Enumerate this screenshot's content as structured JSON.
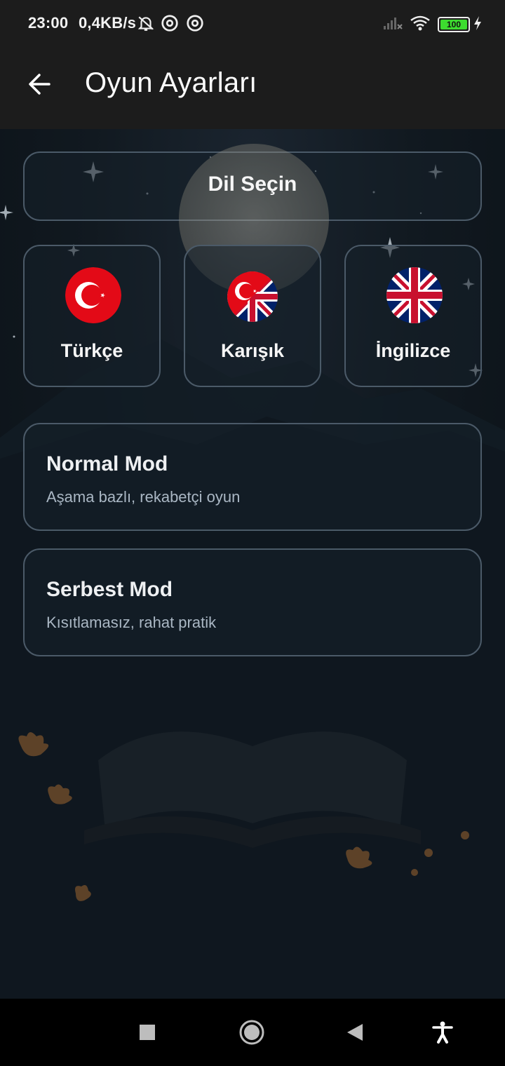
{
  "status_bar": {
    "time": "23:00",
    "network_speed": "0,4KB/s",
    "battery_level": "100",
    "icons": [
      "bell-off-icon",
      "at-sign-icon",
      "at-sign-icon",
      "signal-off-icon",
      "wifi-icon",
      "battery-icon",
      "charging-icon"
    ]
  },
  "app_bar": {
    "title": "Oyun Ayarları",
    "back_icon": "arrow-left-icon"
  },
  "language_section": {
    "title": "Dil Seçin",
    "options": [
      {
        "label": "Türkçe",
        "flag": "turkey-flag-icon"
      },
      {
        "label": "Karışık",
        "flag": "mixed-flag-icon"
      },
      {
        "label": "İngilizce",
        "flag": "uk-flag-icon"
      }
    ]
  },
  "modes": [
    {
      "title": "Normal Mod",
      "subtitle": "Aşama bazlı, rekabetçi oyun"
    },
    {
      "title": "Serbest Mod",
      "subtitle": "Kısıtlamasız, rahat pratik"
    }
  ],
  "colors": {
    "background": "#0b1117",
    "card_border": "#4b5a68",
    "turkey_red": "#e30a17",
    "uk_blue": "#012169",
    "uk_red": "#c8102e",
    "battery_green": "#3ddc2f"
  },
  "nav_bar": {
    "icons": [
      "square-icon",
      "circle-home-icon",
      "triangle-back-icon",
      "accessibility-icon"
    ]
  }
}
